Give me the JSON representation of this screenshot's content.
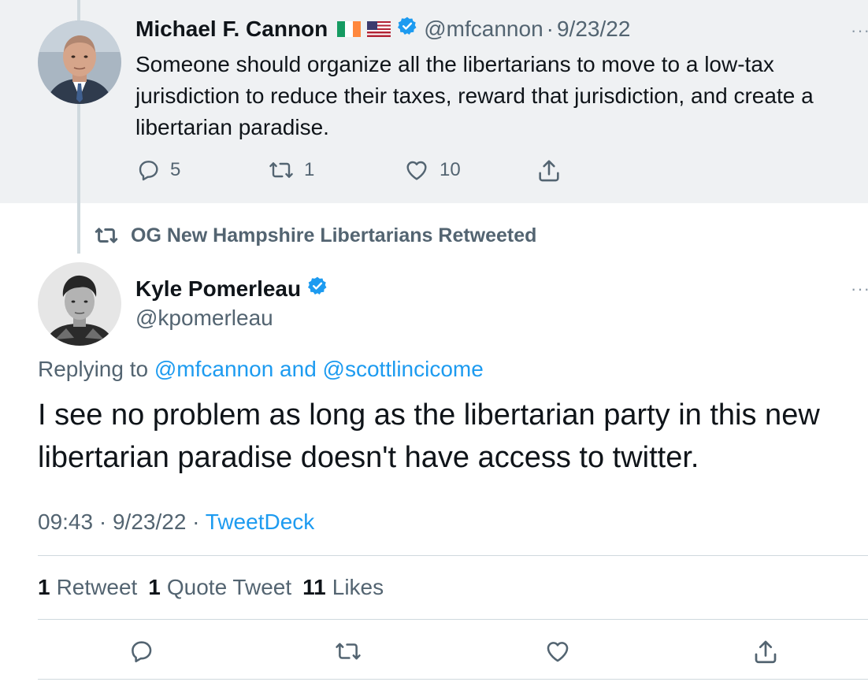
{
  "parent_tweet": {
    "author_name": "Michael F. Cannon",
    "flags": [
      "ireland-flag",
      "us-flag"
    ],
    "handle": "@mfcannon",
    "separator": "·",
    "date": "9/23/22",
    "text": "Someone should organize all the libertarians to move to a low-tax jurisdiction to reduce their taxes, reward that jurisdiction, and create a libertarian paradise.",
    "replies": "5",
    "retweets": "1",
    "likes": "10",
    "more": "···"
  },
  "retweet_notice": "OG New Hampshire Libertarians Retweeted",
  "main_tweet": {
    "author_name": "Kyle Pomerleau",
    "handle": "@kpomerleau",
    "more": "···",
    "replying_prefix": "Replying to",
    "replying_to": "@mfcannon and @scottlincicome",
    "text": "I see no problem as long as the libertarian party in this new libertarian paradise doesn't have access to twitter.",
    "time": "09:43",
    "separator": "·",
    "date": "9/23/22",
    "source": "TweetDeck",
    "stats": {
      "retweets_count": "1",
      "retweets_label": "Retweet",
      "quotes_count": "1",
      "quotes_label": "Quote Tweet",
      "likes_count": "11",
      "likes_label": "Likes"
    }
  },
  "colors": {
    "accent": "#1d9bf0",
    "secondary_text": "#536471",
    "parent_background": "#eff1f3",
    "verified": "#1d9bf0"
  }
}
